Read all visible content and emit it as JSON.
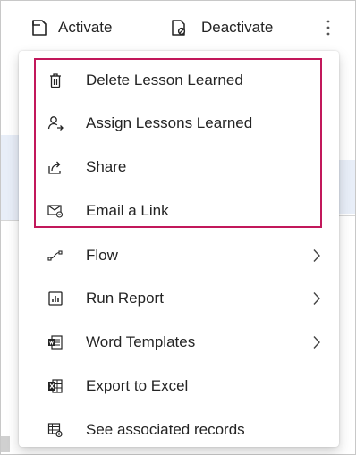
{
  "toolbar": {
    "activate_label": "Activate",
    "deactivate_label": "Deactivate",
    "more_icon": "more-vertical-icon"
  },
  "menu": {
    "items": [
      {
        "label": "Delete Lesson Learned",
        "icon": "trash-icon",
        "submenu": false
      },
      {
        "label": "Assign Lessons Learned",
        "icon": "assign-user-icon",
        "submenu": false
      },
      {
        "label": "Share",
        "icon": "share-icon",
        "submenu": false
      },
      {
        "label": "Email a Link",
        "icon": "email-link-icon",
        "submenu": false
      },
      {
        "label": "Flow",
        "icon": "flow-icon",
        "submenu": true
      },
      {
        "label": "Run Report",
        "icon": "report-icon",
        "submenu": true
      },
      {
        "label": "Word Templates",
        "icon": "word-template-icon",
        "submenu": true
      },
      {
        "label": "Export to Excel",
        "icon": "excel-icon",
        "submenu": false
      },
      {
        "label": "See associated records",
        "icon": "associated-records-icon",
        "submenu": false
      }
    ],
    "highlight_color": "#c2185b"
  }
}
